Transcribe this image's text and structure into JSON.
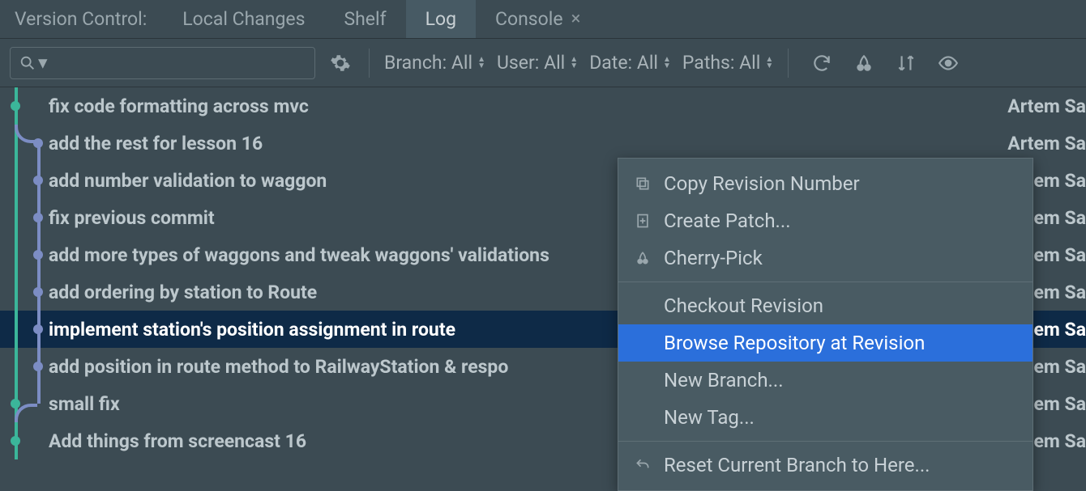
{
  "panel": {
    "title": "Version Control:"
  },
  "tabs": [
    {
      "label": "Local Changes",
      "active": false,
      "closable": false
    },
    {
      "label": "Shelf",
      "active": false,
      "closable": false
    },
    {
      "label": "Log",
      "active": true,
      "closable": false
    },
    {
      "label": "Console",
      "active": false,
      "closable": true
    }
  ],
  "filters": {
    "branch": {
      "label": "Branch:",
      "value": "All"
    },
    "user": {
      "label": "User:",
      "value": "All"
    },
    "date": {
      "label": "Date:",
      "value": "All"
    },
    "paths": {
      "label": "Paths:",
      "value": "All"
    }
  },
  "commits": [
    {
      "msg": "fix code formatting across mvc",
      "author": "Artem Sa",
      "lane": 0,
      "branchStart": false
    },
    {
      "msg": "add the rest for lesson 16",
      "author": "Artem Sa",
      "lane": 1,
      "branchStart": true
    },
    {
      "msg": "add number validation to waggon",
      "author": "em Sa",
      "lane": 1,
      "branchStart": false
    },
    {
      "msg": "fix previous commit",
      "author": "em Sa",
      "lane": 1,
      "branchStart": false
    },
    {
      "msg": "add more types of waggons and tweak waggons' validations",
      "author": "em Sa",
      "lane": 1,
      "branchStart": false
    },
    {
      "msg": "add ordering by station to Route",
      "author": "em Sa",
      "lane": 1,
      "branchStart": false
    },
    {
      "msg": "implement station's position assignment in route",
      "author": "em Sa",
      "lane": 1,
      "branchStart": false,
      "selected": true
    },
    {
      "msg": "add position in route method to RailwayStation & respo",
      "author": "em Sa",
      "lane": 1,
      "branchStart": false
    },
    {
      "msg": "small fix",
      "author": "em Sa",
      "lane": 0,
      "branchStart": false
    },
    {
      "msg": "Add things from screencast 16",
      "author": "em Sa",
      "lane": 0,
      "branchStart": false
    }
  ],
  "context_menu": [
    {
      "label": "Copy Revision Number",
      "icon": "copy",
      "hovered": false
    },
    {
      "label": "Create Patch...",
      "icon": "patch",
      "hovered": false
    },
    {
      "label": "Cherry-Pick",
      "icon": "cherry",
      "hovered": false
    },
    {
      "sep": true
    },
    {
      "label": "Checkout Revision",
      "icon": "",
      "hovered": false
    },
    {
      "label": "Browse Repository at Revision",
      "icon": "",
      "hovered": true
    },
    {
      "label": "New Branch...",
      "icon": "",
      "hovered": false
    },
    {
      "label": "New Tag...",
      "icon": "",
      "hovered": false
    },
    {
      "sep": true
    },
    {
      "label": "Reset Current Branch to Here...",
      "icon": "undo",
      "hovered": false
    }
  ]
}
